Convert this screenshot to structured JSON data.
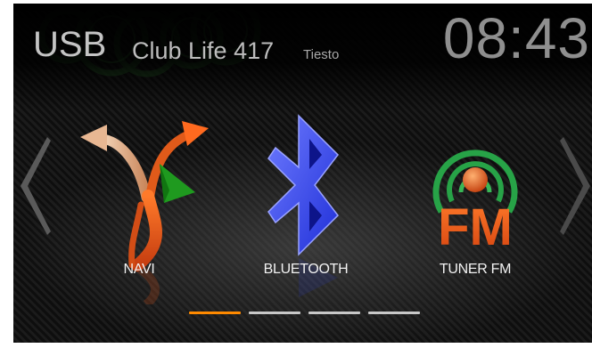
{
  "header": {
    "source": "USB",
    "track": "Club Life 417",
    "artist": "Tiesto",
    "clock": "08:43"
  },
  "tiles": [
    {
      "label": "NAVI",
      "icon": "navigation-arrows-icon"
    },
    {
      "label": "BLUETOOTH",
      "icon": "bluetooth-icon"
    },
    {
      "label": "TUNER FM",
      "icon": "fm-radio-icon",
      "icon_text": "FM"
    }
  ],
  "pager": {
    "pages": 4,
    "active_index": 0
  },
  "colors": {
    "accent": "#ff8a00",
    "rings": "#2f8a2f",
    "bluetooth": "#3b4cff",
    "fm": "#e8541b"
  }
}
